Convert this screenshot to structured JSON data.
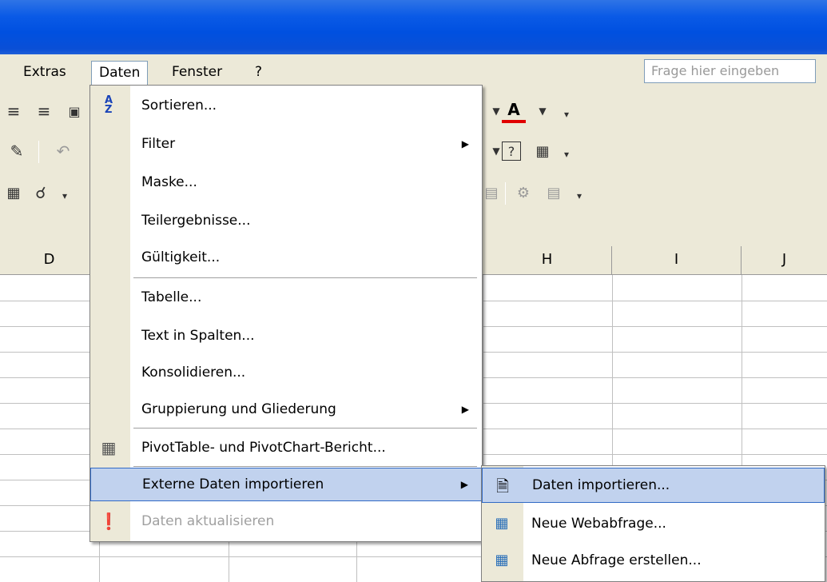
{
  "menubar": {
    "items": [
      {
        "label": "Extras"
      },
      {
        "label": "Daten"
      },
      {
        "label": "Fenster"
      },
      {
        "label": "?"
      }
    ],
    "ask_placeholder": "Frage hier eingeben"
  },
  "columns": [
    "D",
    "H",
    "I",
    "J"
  ],
  "daten_menu": {
    "items": [
      {
        "label": "Sortieren...",
        "icon": "sort-az-icon"
      },
      {
        "label": "Filter",
        "submenu": true
      },
      {
        "label": "Maske..."
      },
      {
        "label": "Teilergebnisse..."
      },
      {
        "label": "Gültigkeit..."
      },
      {
        "label": "Tabelle..."
      },
      {
        "label": "Text in Spalten..."
      },
      {
        "label": "Konsolidieren..."
      },
      {
        "label": "Gruppierung und Gliederung",
        "submenu": true
      },
      {
        "label": "PivotTable- und PivotChart-Bericht...",
        "icon": "pivottable-icon"
      },
      {
        "label": "Externe Daten importieren",
        "submenu": true,
        "highlighted": true
      },
      {
        "label": "Daten aktualisieren",
        "icon": "refresh-data-icon",
        "disabled": true
      }
    ]
  },
  "submenu": {
    "items": [
      {
        "label": "Daten importieren...",
        "icon": "import-data-icon",
        "highlighted": true
      },
      {
        "label": "Neue Webabfrage...",
        "icon": "web-query-icon"
      },
      {
        "label": "Neue Abfrage erstellen...",
        "icon": "new-query-icon"
      }
    ]
  },
  "colors": {
    "titlebar": "#0a5ae6",
    "highlight": "#c1d2ee",
    "highlight_border": "#316ac5",
    "menu_bg": "#ece9d8"
  }
}
